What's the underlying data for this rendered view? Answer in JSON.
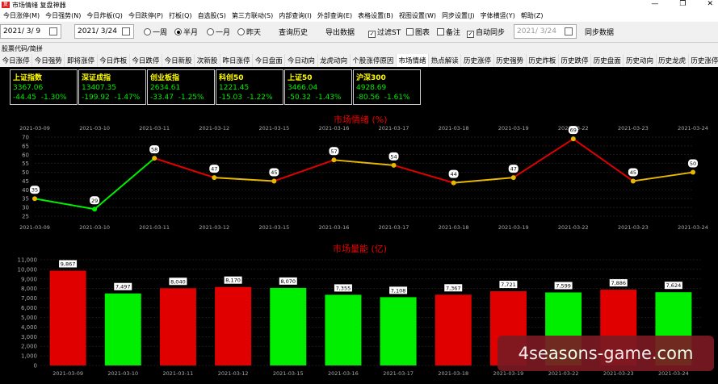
{
  "window": {
    "title": "市场情绪 复盘神器",
    "icon": "app-icon",
    "min_label": "—",
    "max_label": "❐",
    "close_label": "✕"
  },
  "menu": [
    "今日涨停(M)",
    "今日强势(N)",
    "今日炸板(Q)",
    "今日跌停(P)",
    "打板(Q)",
    "自选股(S)",
    "第三方联动(S)",
    "内部查询(I)",
    "外部查询(E)",
    "表格设置(B)",
    "视图设置(W)",
    "同步设置(J)",
    "字体横竖(Y)",
    "帮助(Z)"
  ],
  "toolbar": {
    "start_date": "2021/ 3/ 9",
    "end_date": "2021/ 3/24",
    "periods": [
      "一周",
      "半月",
      "一月",
      "昨天"
    ],
    "period_selected": "半月",
    "history_button": "查询历史",
    "export_button": "导出数据",
    "filter_st": "过滤ST",
    "chart_opt": "图表",
    "note_opt": "备注",
    "auto_sync": "自动同步",
    "sync_date": "2021/ 3/24",
    "sync_button": "同步数据"
  },
  "code_bar": "股票代码/简拼",
  "tabs": [
    "今日涨停",
    "今日强势",
    "即将涨停",
    "今日炸板",
    "今日跌停",
    "今日新股",
    "次新股",
    "昨日涨停",
    "今日盘面",
    "今日动向",
    "龙虎动向",
    "个股涨停原因",
    "市场情绪",
    "热点解读",
    "历史涨停",
    "历史强势",
    "历史炸板",
    "历史跌停",
    "历史盘面",
    "历史动向",
    "历史龙虎",
    "历史涨停原因"
  ],
  "active_tab": "市场情绪",
  "indices": [
    {
      "name": "上证指数",
      "value": "3367.06",
      "change": "-44.45",
      "pct": "-1.30%"
    },
    {
      "name": "深证成指",
      "value": "13407.35",
      "change": "-199.92",
      "pct": "-1.47%"
    },
    {
      "name": "创业板指",
      "value": "2634.61",
      "change": "-33.47",
      "pct": "-1.25%"
    },
    {
      "name": "科创50",
      "value": "1221.45",
      "change": "-15.03",
      "pct": "-1.22%"
    },
    {
      "name": "上证50",
      "value": "3466.04",
      "change": "-50.32",
      "pct": "-1.43%"
    },
    {
      "name": "沪深300",
      "value": "4928.69",
      "change": "-80.56",
      "pct": "-1.61%"
    }
  ],
  "colors": {
    "up": "#e00000",
    "down": "#00ee00",
    "flat": "#e8b800",
    "bg": "#000000",
    "axis": "#aaaaaa"
  },
  "chart_data": [
    {
      "type": "line",
      "title": "市场情绪 (%)",
      "x": [
        "2021-03-09",
        "2021-03-10",
        "2021-03-11",
        "2021-03-12",
        "2021-03-15",
        "2021-03-16",
        "2021-03-17",
        "2021-03-18",
        "2021-03-19",
        "2021-03-22",
        "2021-03-23",
        "2021-03-24"
      ],
      "values": [
        35,
        29,
        58,
        47,
        45,
        57,
        54,
        44,
        47,
        69,
        45,
        50
      ],
      "ylim": [
        25,
        70
      ],
      "yticks": [
        25,
        30,
        35,
        40,
        45,
        50,
        55,
        60,
        65,
        70
      ]
    },
    {
      "type": "bar",
      "title": "市场量能 (亿)",
      "categories": [
        "2021-03-09",
        "2021-03-10",
        "2021-03-11",
        "2021-03-12",
        "2021-03-15",
        "2021-03-16",
        "2021-03-17",
        "2021-03-18",
        "2021-03-19",
        "2021-03-22",
        "2021-03-23",
        "2021-03-24"
      ],
      "values": [
        9867,
        7497,
        8040,
        8170,
        8070,
        7355,
        7108,
        7367,
        7721,
        7599,
        7886,
        7624
      ],
      "labels": [
        "9,867",
        "7,497",
        "8,040",
        "8,170",
        "8,070",
        "7,355",
        "7,108",
        "7,367",
        "7,721",
        "7,599",
        "7,886",
        "7,624"
      ],
      "colors": [
        "up",
        "down",
        "up",
        "up",
        "down",
        "down",
        "down",
        "up",
        "up",
        "down",
        "up",
        "down"
      ],
      "ylim": [
        0,
        11000
      ],
      "yticks": [
        "0",
        "1,000",
        "2,000",
        "3,000",
        "4,000",
        "5,000",
        "6,000",
        "7,000",
        "8,000",
        "9,000",
        "10,000",
        "11,000"
      ]
    }
  ],
  "watermark": "4seasons-game.com"
}
